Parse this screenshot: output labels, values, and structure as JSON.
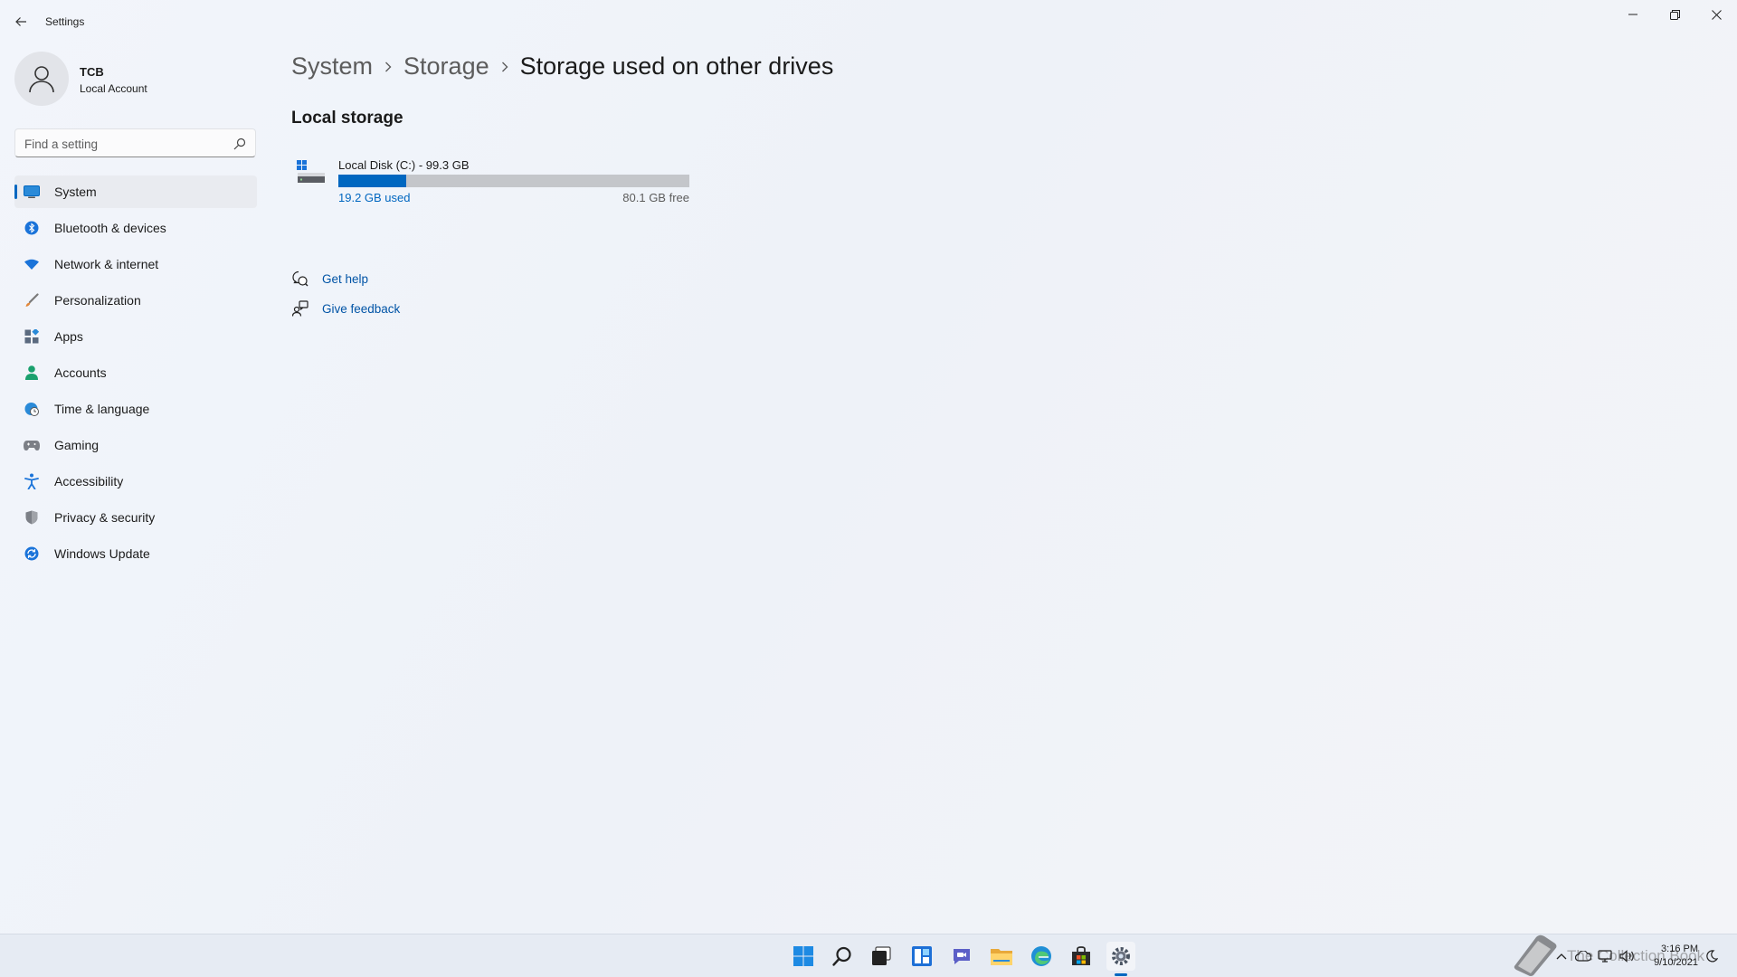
{
  "window": {
    "title": "Settings"
  },
  "profile": {
    "name": "TCB",
    "account_type": "Local Account"
  },
  "search": {
    "placeholder": "Find a setting"
  },
  "nav": {
    "items": [
      {
        "label": "System",
        "icon": "monitor-icon",
        "active": true
      },
      {
        "label": "Bluetooth & devices",
        "icon": "bluetooth-icon"
      },
      {
        "label": "Network & internet",
        "icon": "wifi-icon"
      },
      {
        "label": "Personalization",
        "icon": "brush-icon"
      },
      {
        "label": "Apps",
        "icon": "apps-icon"
      },
      {
        "label": "Accounts",
        "icon": "person-icon"
      },
      {
        "label": "Time & language",
        "icon": "globe-clock-icon"
      },
      {
        "label": "Gaming",
        "icon": "gamepad-icon"
      },
      {
        "label": "Accessibility",
        "icon": "accessibility-icon"
      },
      {
        "label": "Privacy & security",
        "icon": "shield-icon"
      },
      {
        "label": "Windows Update",
        "icon": "update-icon"
      }
    ]
  },
  "breadcrumb": {
    "items": [
      "System",
      "Storage",
      "Storage used on other drives"
    ]
  },
  "content": {
    "section_title": "Local storage",
    "drive": {
      "name": "Local Disk (C:) - 99.3 GB",
      "used_label": "19.2 GB used",
      "free_label": "80.1 GB free",
      "used_fraction": 0.193
    },
    "links": [
      {
        "label": "Get help",
        "icon": "help-chat-icon"
      },
      {
        "label": "Give feedback",
        "icon": "feedback-icon"
      }
    ]
  },
  "taskbar": {
    "apps": [
      "start-icon",
      "search-icon",
      "task-view-icon",
      "widgets-icon",
      "chat-icon",
      "file-explorer-icon",
      "edge-icon",
      "store-icon",
      "settings-icon"
    ],
    "active_app": "settings-icon",
    "clock_time": "3:16 PM",
    "clock_date": "9/10/2021",
    "watermark": "The Collection Book"
  },
  "colors": {
    "accent": "#0067c0",
    "link": "#0054a6",
    "bar_track": "#c4c6ca"
  }
}
